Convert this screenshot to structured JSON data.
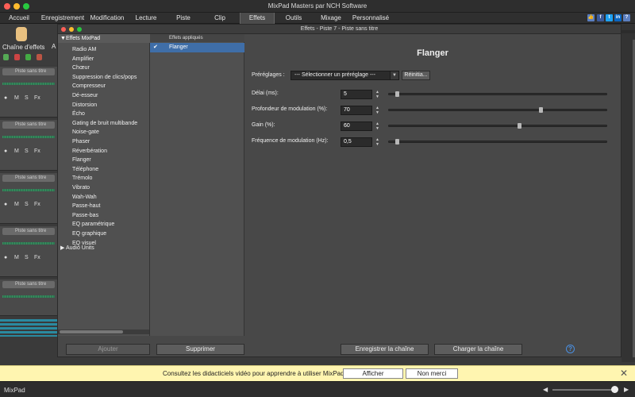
{
  "window": {
    "title": "MixPad Masters par NCH Software"
  },
  "tabs": [
    {
      "label": "Accueil"
    },
    {
      "label": "Enregistrement"
    },
    {
      "label": "Modification"
    },
    {
      "label": "Lecture"
    },
    {
      "label": "Piste"
    },
    {
      "label": "Clip"
    },
    {
      "label": "Effets"
    },
    {
      "label": "Outils"
    },
    {
      "label": "Mixage"
    },
    {
      "label": "Personnalisé"
    }
  ],
  "toolbar": {
    "chain_label": "Chaîne d'effets"
  },
  "tracks": {
    "name": "Piste sans titre",
    "ctl": {
      "m": "M",
      "s": "S",
      "fx": "Fx"
    }
  },
  "dialog": {
    "title": "Effets - Piste 7 - Piste sans titre",
    "tree_root": "Effets MixPad",
    "effects": [
      "Radio AM",
      "Amplifier",
      "Chœur",
      "Suppression de clics/pops",
      "Compresseur",
      "Dé-esseur",
      "Distorsion",
      "Écho",
      "Gating de bruit multibande",
      "Noise-gate",
      "Phaser",
      "Réverbération",
      "Flanger",
      "Téléphone",
      "Trémolo",
      "Vibrato",
      "Wah-Wah",
      "Passe-haut",
      "Passe-bas",
      "EQ paramétrique",
      "EQ graphique",
      "EQ visuel"
    ],
    "tree_collapsed": "Audio Units",
    "applied_header": "Effets appliqués",
    "applied_item": "Flanger",
    "effect_name": "Flanger",
    "presets_label": "Préréglages :",
    "preset_value": "--- Sélectionner un préréglage ---",
    "reset_label": "Réinitia...",
    "params": [
      {
        "label": "Délai (ms):",
        "value": "5",
        "fraction": 0.03
      },
      {
        "label": "Profondeur de modulation (%):",
        "value": "70",
        "fraction": 0.7
      },
      {
        "label": "Gain (%):",
        "value": "60",
        "fraction": 0.6
      },
      {
        "label": "Fréquence de modulation (Hz):",
        "value": "0,5",
        "fraction": 0.03
      }
    ],
    "buttons": {
      "add": "Ajouter",
      "remove": "Supprimer",
      "save_chain": "Enregistrer la chaîne",
      "load_chain": "Charger la chaîne",
      "help": "?"
    }
  },
  "notification": {
    "text": "Consultez les didacticiels vidéo pour apprendre à utiliser MixPad",
    "show": "Afficher",
    "no_thanks": "Non merci"
  },
  "status": {
    "text": "MixPad"
  }
}
